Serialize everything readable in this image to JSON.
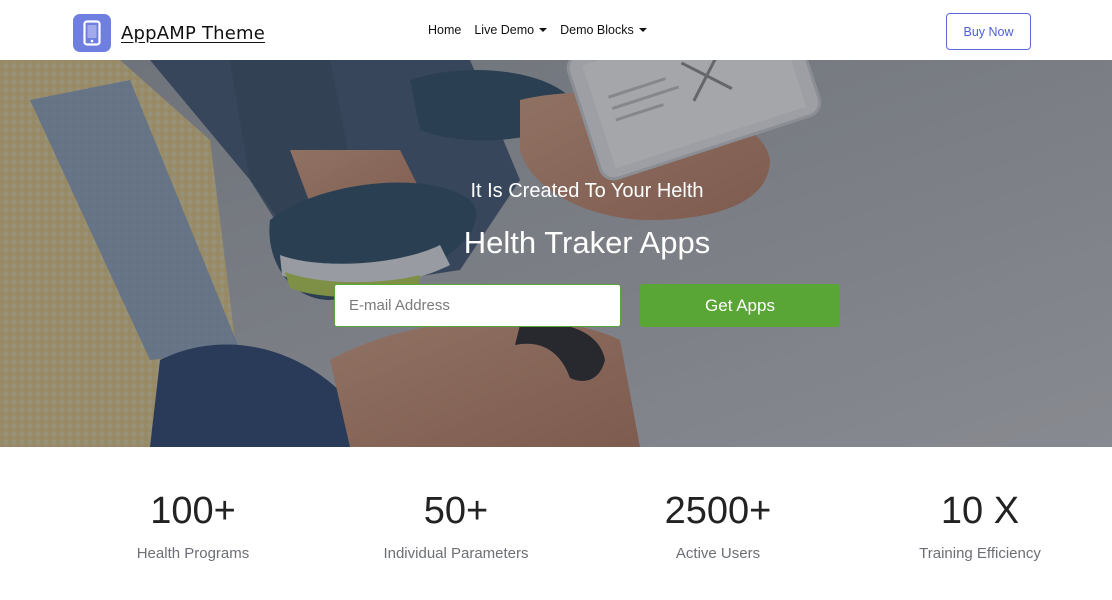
{
  "header": {
    "brand_name": "AppAMP Theme",
    "brand_icon": "smartphone-icon",
    "nav": [
      {
        "label": "Home",
        "dropdown": false
      },
      {
        "label": "Live Demo",
        "dropdown": true
      },
      {
        "label": "Demo Blocks",
        "dropdown": true
      }
    ],
    "buy_label": "Buy Now"
  },
  "hero": {
    "kicker": "It Is Created To Your Helth",
    "title": "Helth Traker Apps",
    "email_placeholder": "E-mail Address",
    "button_label": "Get Apps"
  },
  "stats": [
    {
      "value": "100+",
      "label": "Health Programs"
    },
    {
      "value": "50+",
      "label": "Individual Parameters"
    },
    {
      "value": "2500+",
      "label": "Active Users"
    },
    {
      "value": "10 X",
      "label": "Training Efficiency"
    }
  ],
  "colors": {
    "accent_blue": "#6f7fe0",
    "button_green": "#59a637",
    "buy_border": "#5a6bd8"
  }
}
